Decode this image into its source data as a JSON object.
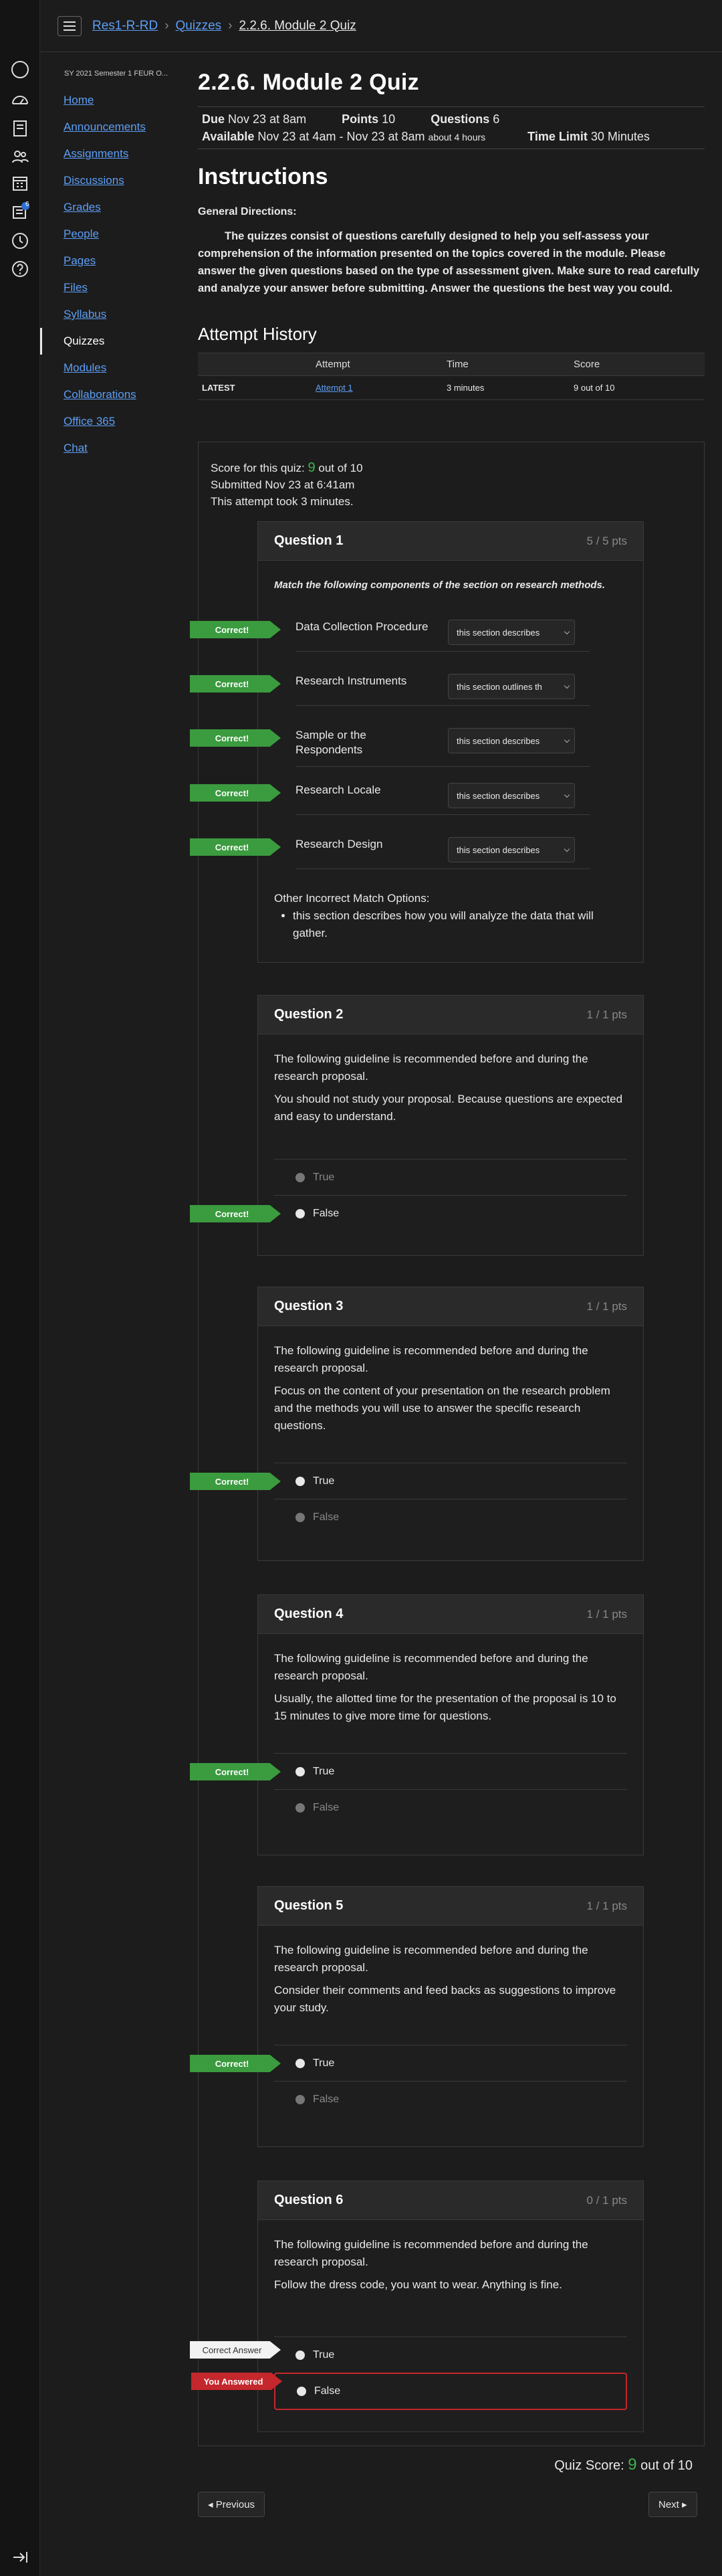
{
  "breadcrumb": {
    "course": "Res1-R-RD",
    "section": "Quizzes",
    "page": "2.2.6. Module 2 Quiz"
  },
  "global_nav": {
    "icons": [
      "account-icon",
      "dashboard-icon",
      "courses-icon",
      "groups-icon",
      "calendar-icon",
      "inbox-icon",
      "history-icon",
      "help-icon",
      "collapse-nav-icon"
    ],
    "inbox_badge": "6"
  },
  "course_nav": {
    "term": "SY 2021 Semester 1 FEUR O...",
    "items": [
      "Home",
      "Announcements",
      "Assignments",
      "Discussions",
      "Grades",
      "People",
      "Pages",
      "Files",
      "Syllabus",
      "Quizzes",
      "Modules",
      "Collaborations",
      "Office 365",
      "Chat"
    ],
    "active": "Quizzes"
  },
  "quiz": {
    "title": "2.2.6. Module 2 Quiz",
    "due_label": "Due",
    "due": "Nov 23 at 8am",
    "points_label": "Points",
    "points": "10",
    "questions_label": "Questions",
    "questions": "6",
    "available_label": "Available",
    "available": "Nov 23 at 4am - Nov 23 at 8am",
    "available_note": "about 4 hours",
    "time_limit_label": "Time Limit",
    "time_limit": "30 Minutes"
  },
  "instructions": {
    "heading": "Instructions",
    "sub": "General Directions:",
    "text": "The quizzes consist of questions carefully designed to help you self-assess your comprehension of the information presented on the topics covered in the module. Please answer the given questions based on the type of assessment given. Make sure to read carefully and analyze your answer before submitting.  Answer the questions the best way you could."
  },
  "history": {
    "heading": "Attempt History",
    "cols": [
      "Attempt",
      "Time",
      "Score"
    ],
    "row": {
      "tag": "LATEST",
      "attempt": "Attempt 1",
      "time": "3 minutes",
      "score": "9 out of 10"
    }
  },
  "summary": {
    "score_prefix": "Score for this quiz: ",
    "score": "9",
    "score_suffix": " out of 10",
    "submitted": "Submitted Nov 23 at 6:41am",
    "duration": "This attempt took 3 minutes."
  },
  "flags": {
    "correct": "Correct!",
    "correct_answer": "Correct Answer",
    "you_answered": "You Answered"
  },
  "q1": {
    "title": "Question 1",
    "pts": "5 / 5 pts",
    "prompt": "Match the following components of the section on research methods.",
    "pairs": [
      {
        "label": "Data Collection Procedure",
        "value": "this section describes"
      },
      {
        "label": "Research Instruments",
        "value": "this section outlines th"
      },
      {
        "label": "Sample or the Respondents",
        "value": "this section describes"
      },
      {
        "label": "Research Locale",
        "value": "this section describes"
      },
      {
        "label": "Research Design",
        "value": "this section describes"
      }
    ],
    "other_heading": "Other Incorrect Match Options:",
    "other_item": "this section describes how you will analyze the data that will gather."
  },
  "lead": "The following guideline is recommended before and during the research proposal.",
  "q2": {
    "title": "Question 2",
    "pts": "1 / 1 pts",
    "text": "You should not study your proposal. Because questions are expected and easy to understand.",
    "a": "True",
    "b": "False"
  },
  "q3": {
    "title": "Question 3",
    "pts": "1 / 1 pts",
    "text": "Focus on the content of your presentation on the research problem and the methods you will use to answer the specific research questions.",
    "a": "True",
    "b": "False"
  },
  "q4": {
    "title": "Question 4",
    "pts": "1 / 1 pts",
    "text": "Usually, the allotted time for the presentation of the proposal is 10 to 15 minutes to give more time for questions.",
    "a": "True",
    "b": "False"
  },
  "q5": {
    "title": "Question 5",
    "pts": "1 / 1 pts",
    "text": "Consider their comments and feed backs as suggestions to improve your study.",
    "a": "True",
    "b": "False"
  },
  "q6": {
    "title": "Question 6",
    "pts": "0 / 1 pts",
    "text": "Follow the dress code,  you want to wear. Anything is fine.",
    "a": "True",
    "b": "False"
  },
  "final": {
    "label": "Quiz Score: ",
    "score": "9",
    "suffix": " out of 10"
  },
  "pager": {
    "prev": "◂ Previous",
    "next": "Next ▸"
  }
}
